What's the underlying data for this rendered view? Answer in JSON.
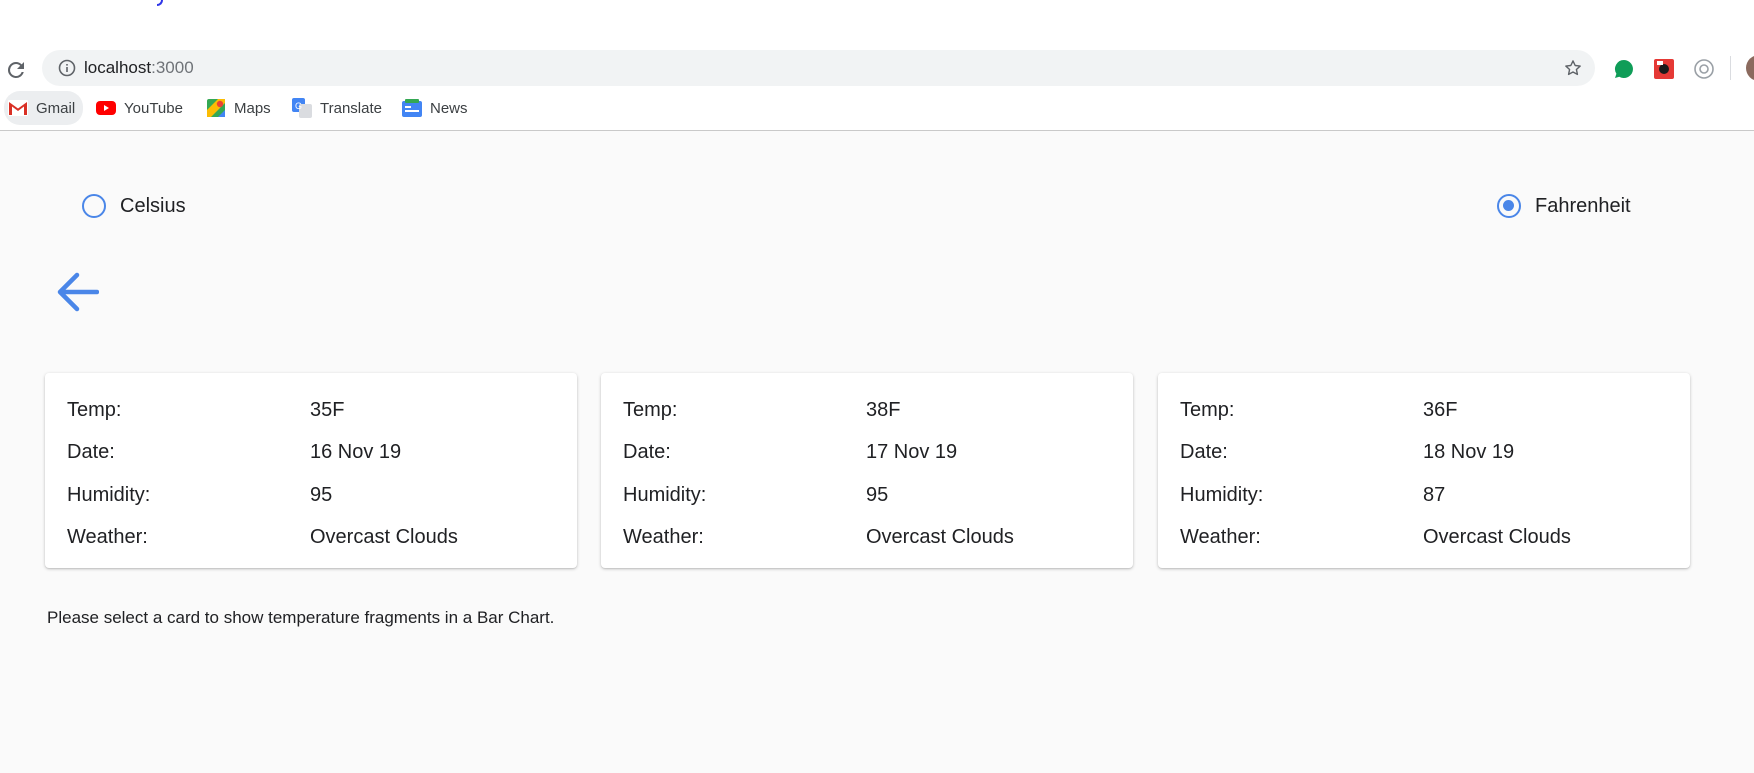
{
  "browser": {
    "url_host": "localhost",
    "url_port": ":3000",
    "bookmarks": [
      {
        "label": "Gmail",
        "icon": "gmail-icon"
      },
      {
        "label": "YouTube",
        "icon": "youtube-icon"
      },
      {
        "label": "Maps",
        "icon": "maps-icon"
      },
      {
        "label": "Translate",
        "icon": "translate-icon"
      },
      {
        "label": "News",
        "icon": "news-icon"
      }
    ]
  },
  "units": {
    "celsius_label": "Celsius",
    "fahrenheit_label": "Fahrenheit",
    "selected": "Fahrenheit"
  },
  "labels": {
    "temp": "Temp:",
    "date": "Date:",
    "humidity": "Humidity:",
    "weather": "Weather:"
  },
  "cards": [
    {
      "temp": "35F",
      "date": "16 Nov 19",
      "humidity": "95",
      "weather": "Overcast Clouds"
    },
    {
      "temp": "38F",
      "date": "17 Nov 19",
      "humidity": "95",
      "weather": "Overcast Clouds"
    },
    {
      "temp": "36F",
      "date": "18 Nov 19",
      "humidity": "87",
      "weather": "Overcast Clouds"
    }
  ],
  "hint": "Please select a card to show temperature fragments in a Bar Chart.",
  "colors": {
    "accent": "#4a86e8"
  }
}
